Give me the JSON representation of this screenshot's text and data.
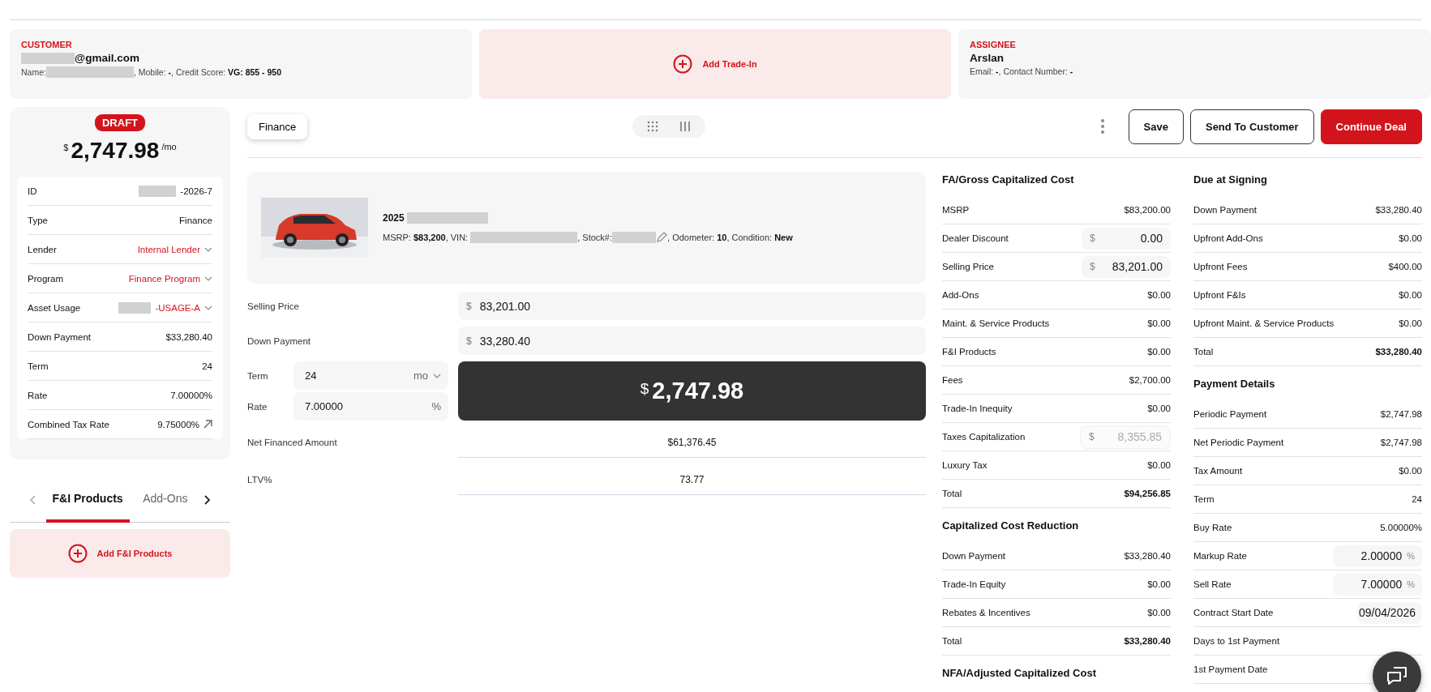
{
  "customer": {
    "label": "CUSTOMER",
    "email": "@gmail.com",
    "details_1": "Name:",
    "details_2": ", Mobile: **-**, Credit Score: **VG: 855 - 950**"
  },
  "trade_in": {
    "label": "Add Trade-In"
  },
  "assignee": {
    "label": "ASSIGNEE",
    "name": "Arslan",
    "details": "Email: **-**, Contact Number: **-**"
  },
  "summary": {
    "status": "DRAFT",
    "currency": "$",
    "amount": "2,747.98",
    "period": "/mo",
    "rows": [
      {
        "label": "ID",
        "value": "-2026-7",
        "kind": "text",
        "redacted": true
      },
      {
        "label": "Type",
        "value": "Finance",
        "kind": "text",
        "redacted": false
      },
      {
        "label": "Lender",
        "value": "Internal Lender",
        "kind": "select",
        "redacted": false
      },
      {
        "label": "Program",
        "value": "Finance Program",
        "kind": "select",
        "redacted": false
      },
      {
        "label": "Asset Usage",
        "value": "-USAGE-A",
        "kind": "select",
        "redacted": true
      },
      {
        "label": "Down Payment",
        "value": "$33,280.40",
        "kind": "text",
        "redacted": false
      },
      {
        "label": "Term",
        "value": "24",
        "kind": "text",
        "redacted": false
      },
      {
        "label": "Rate",
        "value": "7.00000%",
        "kind": "text",
        "redacted": false
      },
      {
        "label": "Combined Tax Rate",
        "value": "9.75000%",
        "kind": "link",
        "redacted": false
      }
    ]
  },
  "product_tabs": [
    {
      "label": "F&I Products",
      "selected": true
    },
    {
      "label": "Add-Ons",
      "selected": false
    }
  ],
  "add_products": {
    "label": "Add F&I Products"
  },
  "toolbar": {
    "deal_type": "Finance",
    "buttons": [
      {
        "label": "Save",
        "kind": "outline"
      },
      {
        "label": "Send To Customer",
        "kind": "outline"
      },
      {
        "label": "Continue Deal",
        "kind": "primary"
      }
    ]
  },
  "vehicle": {
    "year": "2025",
    "details_1": "MSRP: **$83,200**, VIN:",
    "details_2": ", Stock#:",
    "details_3": ", Odometer: **10**, Condition: **New**",
    "kind": "picture"
  },
  "form": {
    "selling_price": {
      "label": "Selling Price",
      "prefix": "$",
      "value": "83,201.00"
    },
    "down_payment": {
      "label": "Down Payment",
      "prefix": "$",
      "value": "33,280.40"
    },
    "term": {
      "label": "Term",
      "value": "24",
      "unit": "mo"
    },
    "rate": {
      "label": "Rate",
      "value": "7.00000",
      "unit": "%"
    },
    "payment": {
      "currency": "$",
      "amount": "2,747.98"
    },
    "net_financed": {
      "label": "Net Financed Amount",
      "value": "$61,376.45"
    },
    "ltv": {
      "label": "LTV%",
      "value": "73.77"
    }
  },
  "columns": [
    [
      {
        "title": "FA/Gross Capitalized Cost",
        "rows": [
          {
            "label": "MSRP",
            "value": "$83,200.00",
            "kind": "text"
          },
          {
            "label": "Dealer Discount",
            "value": "0.00",
            "prefix": "$",
            "kind": "money_field",
            "disabled": false
          },
          {
            "label": "Selling Price",
            "value": "83,201.00",
            "prefix": "$",
            "kind": "money_field",
            "disabled": false
          },
          {
            "label": "Add-Ons",
            "value": "$0.00",
            "kind": "text"
          },
          {
            "label": "Maint. & Service Products",
            "value": "$0.00",
            "kind": "text"
          },
          {
            "label": "F&I Products",
            "value": "$0.00",
            "kind": "text"
          },
          {
            "label": "Fees",
            "value": "$2,700.00",
            "kind": "text"
          },
          {
            "label": "Trade-In Inequity",
            "value": "$0.00",
            "kind": "text"
          },
          {
            "label": "Taxes Capitalization",
            "value": "8,355.85",
            "prefix": "$",
            "kind": "money_field",
            "disabled": true
          },
          {
            "label": "Luxury Tax",
            "value": "$0.00",
            "kind": "text"
          },
          {
            "label": "Total",
            "value": "$94,256.85",
            "kind": "total"
          }
        ]
      },
      {
        "title": "Capitalized Cost Reduction",
        "rows": [
          {
            "label": "Down Payment",
            "value": "$33,280.40",
            "kind": "text"
          },
          {
            "label": "Trade-In Equity",
            "value": "$0.00",
            "kind": "text"
          },
          {
            "label": "Rebates & Incentives",
            "value": "$0.00",
            "kind": "text"
          },
          {
            "label": "Total",
            "value": "$33,280.40",
            "kind": "total"
          }
        ]
      },
      {
        "title": "NFA/Adjusted Capitalized Cost"
      }
    ],
    [
      {
        "title": "Due at Signing",
        "rows": [
          {
            "label": "Down Payment",
            "value": "$33,280.40",
            "kind": "text"
          },
          {
            "label": "Upfront Add-Ons",
            "value": "$0.00",
            "kind": "text"
          },
          {
            "label": "Upfront Fees",
            "value": "$400.00",
            "kind": "text"
          },
          {
            "label": "Upfront F&Is",
            "value": "$0.00",
            "kind": "text"
          },
          {
            "label": "Upfront Maint. & Service Products",
            "value": "$0.00",
            "kind": "text"
          },
          {
            "label": "Total",
            "value": "$33,280.40",
            "kind": "total"
          }
        ]
      },
      {
        "title": "Payment Details",
        "rows": [
          {
            "label": "Periodic Payment",
            "value": "$2,747.98",
            "kind": "text"
          },
          {
            "label": "Net Periodic Payment",
            "value": "$2,747.98",
            "kind": "text"
          },
          {
            "label": "Tax Amount",
            "value": "$0.00",
            "kind": "text"
          },
          {
            "label": "Term",
            "value": "24",
            "kind": "text"
          },
          {
            "label": "Buy Rate",
            "value": "5.00000%",
            "kind": "text"
          },
          {
            "label": "Markup Rate",
            "value": "2.00000",
            "unit": "%",
            "kind": "percent_field"
          },
          {
            "label": "Sell Rate",
            "value": "7.00000",
            "unit": "%",
            "kind": "percent_field"
          },
          {
            "label": "Contract Start Date",
            "value": "09/04/2026",
            "kind": "date_field"
          },
          {
            "label": "Days to 1st Payment",
            "kind": "hidden_field"
          },
          {
            "label": "1st Payment Date",
            "kind": "hidden_field"
          }
        ]
      }
    ]
  ]
}
